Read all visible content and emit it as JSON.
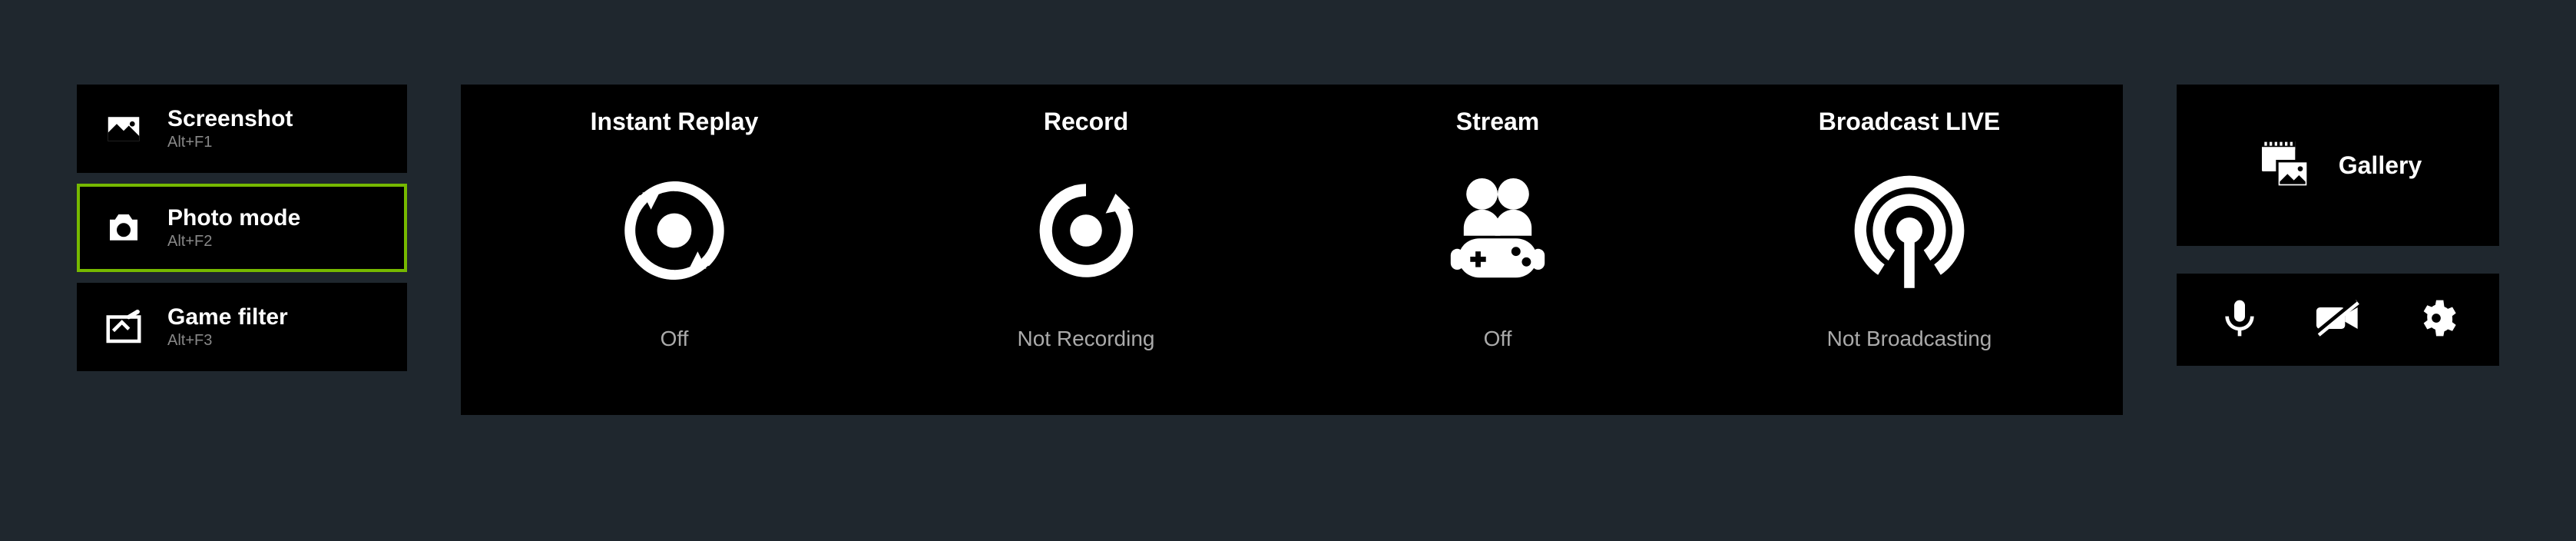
{
  "left": {
    "items": [
      {
        "label": "Screenshot",
        "shortcut": "Alt+F1",
        "selected": false
      },
      {
        "label": "Photo mode",
        "shortcut": "Alt+F2",
        "selected": true
      },
      {
        "label": "Game filter",
        "shortcut": "Alt+F3",
        "selected": false
      }
    ]
  },
  "center": {
    "items": [
      {
        "label": "Instant Replay",
        "status": "Off"
      },
      {
        "label": "Record",
        "status": "Not Recording"
      },
      {
        "label": "Stream",
        "status": "Off"
      },
      {
        "label": "Broadcast LIVE",
        "status": "Not Broadcasting"
      }
    ]
  },
  "right": {
    "gallery_label": "Gallery"
  }
}
